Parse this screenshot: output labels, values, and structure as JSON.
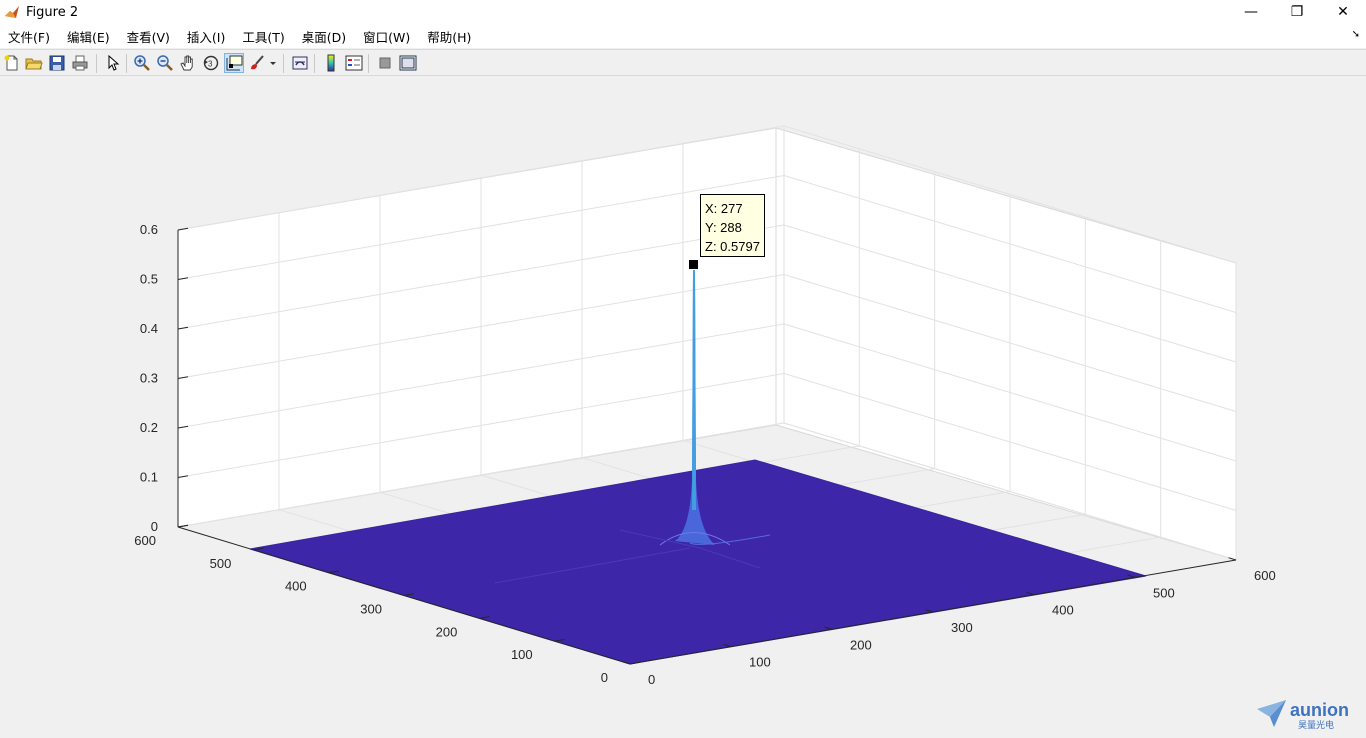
{
  "window": {
    "title": "Figure 2",
    "minimize": "—",
    "maximize": "❐",
    "close": "✕"
  },
  "menu": [
    "文件(F)",
    "编辑(E)",
    "查看(V)",
    "插入(I)",
    "工具(T)",
    "桌面(D)",
    "窗口(W)",
    "帮助(H)"
  ],
  "menu_dock": "➘",
  "toolbar": {
    "icons": [
      "new-figure-icon",
      "open-file-icon",
      "save-icon",
      "print-icon",
      "pointer-icon",
      "zoom-in-icon",
      "zoom-out-icon",
      "pan-hand-icon",
      "rotate-3d-icon",
      "data-cursor-icon",
      "brush-icon",
      "link-plot-icon",
      "colorbar-icon",
      "legend-icon",
      "hide-plot-tools-icon",
      "show-plot-tools-icon"
    ]
  },
  "axes": {
    "z_ticks": [
      "0",
      "0.1",
      "0.2",
      "0.3",
      "0.4",
      "0.5",
      "0.6"
    ],
    "y_ticks": [
      "0",
      "100",
      "200",
      "300",
      "400",
      "500",
      "600"
    ],
    "x_ticks": [
      "0",
      "100",
      "200",
      "300",
      "400",
      "500",
      "600"
    ]
  },
  "chart_data": {
    "type": "surface",
    "xlim": [
      0,
      600
    ],
    "ylim": [
      0,
      600
    ],
    "zlim": [
      0,
      0.6
    ],
    "peak": {
      "x": 277,
      "y": 288,
      "z": 0.5797
    },
    "colors": {
      "base": "#3d26a8",
      "peak": "#40a0e0"
    },
    "grid": true
  },
  "datatip": {
    "x": "X: 277",
    "y": "Y: 288",
    "z": "Z: 0.5797"
  },
  "logo": {
    "text": "aunion",
    "subtext": "昊量光电"
  }
}
